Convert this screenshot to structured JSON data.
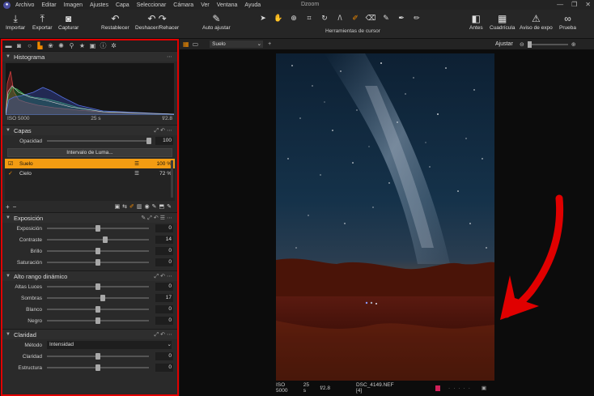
{
  "app": {
    "title": "Dzoom"
  },
  "menu": [
    "Archivo",
    "Editar",
    "Imagen",
    "Ajustes",
    "Capa",
    "Seleccionar",
    "Cámara",
    "Ver",
    "Ventana",
    "Ayuda"
  ],
  "toolbar": {
    "import_label": "Importar",
    "export_label": "Exportar",
    "capture_label": "Capturar",
    "reset_label": "Restablecer",
    "undo_redo_label": "Deshacer/Rehacer",
    "auto_adjust_label": "Auto ajustar",
    "cursor_tools_label": "Herramientas de cursor",
    "before_label": "Antes",
    "grid_label": "Cuadrícula",
    "exposure_warning_label": "Aviso de expo",
    "proof_label": "Prueba"
  },
  "histogram": {
    "title": "Histograma",
    "iso": "ISO 5000",
    "shutter": "25 s",
    "aperture": "f/2.8"
  },
  "layers": {
    "title": "Capas",
    "opacity_label": "Opacidad",
    "opacity_value": "100",
    "opacity_fraction": 1.0,
    "luma_button": "Intervalo de Luma...",
    "items": [
      {
        "name": "Suelo",
        "value": "100 %",
        "selected": true
      },
      {
        "name": "Cielo",
        "value": "72 %",
        "selected": false
      }
    ]
  },
  "exposure": {
    "title": "Exposición",
    "rows": [
      {
        "label": "Exposición",
        "value": "0",
        "fraction": 0.5
      },
      {
        "label": "Contraste",
        "value": "14",
        "fraction": 0.57
      },
      {
        "label": "Brillo",
        "value": "0",
        "fraction": 0.5
      },
      {
        "label": "Saturación",
        "value": "0",
        "fraction": 0.5
      }
    ]
  },
  "hdr": {
    "title": "Alto rango dinámico",
    "rows": [
      {
        "label": "Altas Luces",
        "value": "0",
        "fraction": 0.5
      },
      {
        "label": "Sombras",
        "value": "17",
        "fraction": 0.55
      },
      {
        "label": "Blanco",
        "value": "0",
        "fraction": 0.5
      },
      {
        "label": "Negro",
        "value": "0",
        "fraction": 0.5
      }
    ]
  },
  "clarity": {
    "title": "Claridad",
    "method_label": "Método",
    "method_value": "Intensidad",
    "rows": [
      {
        "label": "Claridad",
        "value": "0",
        "fraction": 0.5
      },
      {
        "label": "Estructura",
        "value": "0",
        "fraction": 0.5
      }
    ]
  },
  "viewer": {
    "view_name": "Suelo",
    "fit_label": "Ajustar"
  },
  "photo_info": {
    "iso": "ISO 5000",
    "shutter": "25 s",
    "aperture": "f/2.8",
    "filename": "DSC_4149.NEF [4]"
  },
  "colors": {
    "accent": "#f08a00",
    "highlight_border": "#e10000",
    "layer_selected": "#f39c12"
  }
}
